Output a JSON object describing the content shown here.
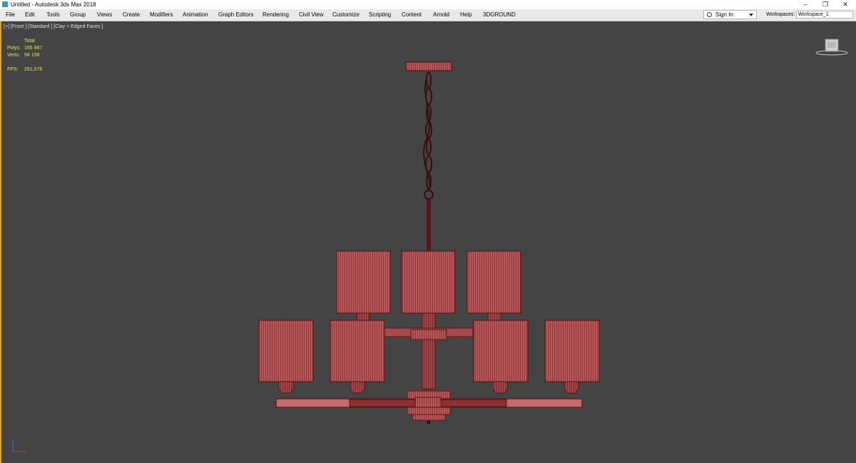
{
  "window": {
    "title": "Untitled - Autodesk 3ds Max 2018",
    "controls": [
      "–",
      "❐",
      "✕"
    ]
  },
  "menu": {
    "items": [
      "File",
      "Edit",
      "Tools",
      "Group",
      "Views",
      "Create",
      "Modifiers",
      "Animation",
      "Graph Editors",
      "Rendering",
      "Civil View",
      "Customize",
      "Scripting",
      "Content",
      "Arnold",
      "Help",
      "3DGROUND"
    ]
  },
  "account": {
    "sign_in": "Sign In"
  },
  "workspaces": {
    "label": "Workspaces:",
    "value": "Workspace_1"
  },
  "viewport": {
    "label": "[+] [Front ] [Standard ] [Clay + Edged Faces ]",
    "stats": {
      "header": "Total",
      "polys_label": "Polys:",
      "polys_value": "165 987",
      "verts_label": "Verts:",
      "verts_value": "94 158",
      "fps_label": "FPS:",
      "fps_value": "261,076"
    }
  },
  "colors": {
    "viewport_bg": "#444444",
    "mesh_fill": "#b9585a",
    "mesh_edge": "#5a1516",
    "stats_text": "#e3e35a",
    "active_border": "#d4a82a"
  },
  "icons": {
    "app": "3ds-max-logo-icon",
    "user": "user-icon",
    "viewcube": "viewcube-icon",
    "axis": "axis-tripod-icon"
  }
}
